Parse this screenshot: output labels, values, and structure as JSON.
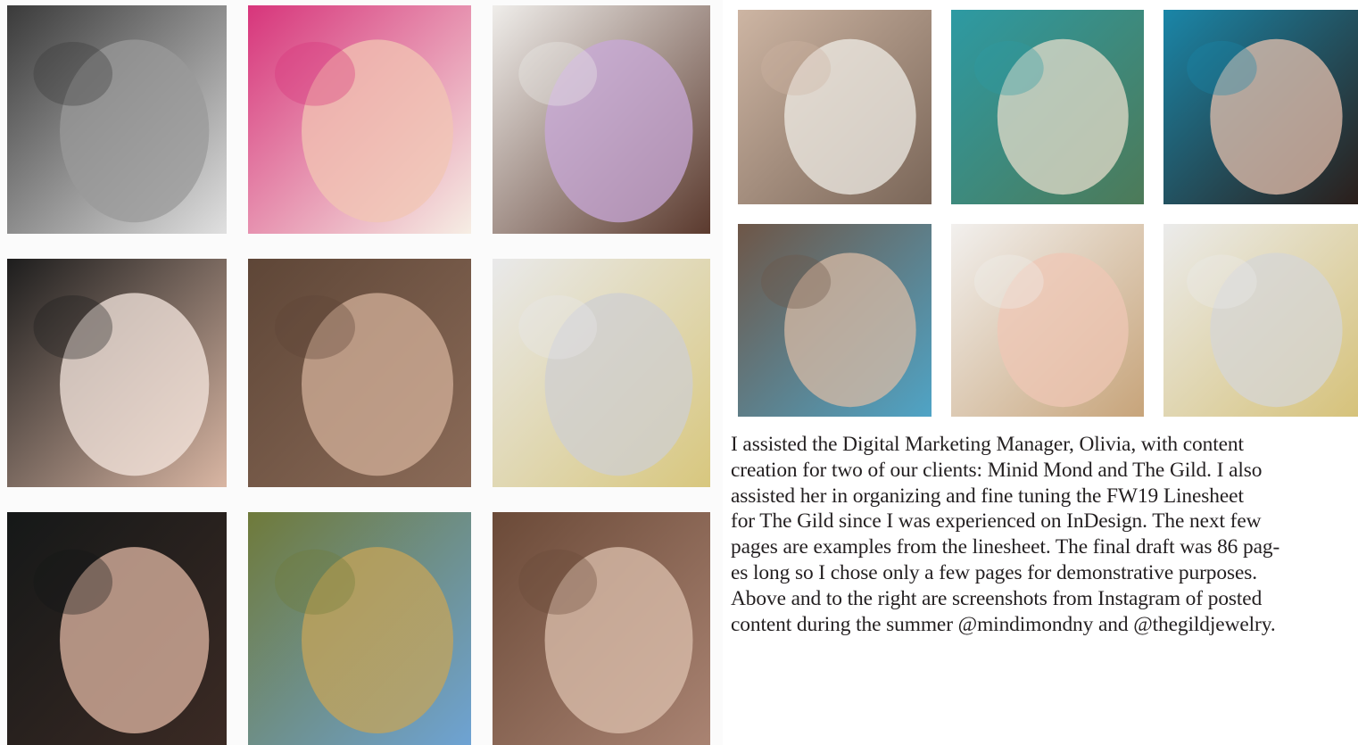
{
  "left_grid": {
    "tiles": [
      {
        "name": "vintage-bw-photo",
        "palette": [
          "#3a3a3a",
          "#9a9a9a",
          "#e0e0e0"
        ]
      },
      {
        "name": "hand-rings-pink-peony",
        "palette": [
          "#d7357b",
          "#f1c5b3",
          "#f6eee4"
        ]
      },
      {
        "name": "woman-lilac-dress",
        "palette": [
          "#efedea",
          "#c8a8d8",
          "#5b3a2e"
        ]
      },
      {
        "name": "hand-rings-lattice",
        "palette": [
          "#1d1d1d",
          "#f5e7df",
          "#d9b6a3"
        ]
      },
      {
        "name": "earring-brown-hair",
        "palette": [
          "#5e4637",
          "#d3b09a",
          "#8b6b58"
        ]
      },
      {
        "name": "bangles-marble",
        "palette": [
          "#e9e9ea",
          "#cfcfd1",
          "#d8c77e"
        ]
      },
      {
        "name": "woman-black-gown",
        "palette": [
          "#151818",
          "#e2b8a4",
          "#3b2a24"
        ]
      },
      {
        "name": "wizard-of-oz-still",
        "palette": [
          "#6f7a3a",
          "#c6a45a",
          "#6ea3d4"
        ]
      },
      {
        "name": "earring-side-profile",
        "palette": [
          "#6b4a38",
          "#dcc0ae",
          "#a98372"
        ]
      }
    ]
  },
  "right_grid": {
    "tiles": [
      {
        "name": "hand-wide-rings",
        "palette": [
          "#cdb5a3",
          "#efece6",
          "#7a6658"
        ]
      },
      {
        "name": "hotel-postcard-collage",
        "palette": [
          "#2d9aa3",
          "#e4dccb",
          "#4d7a58"
        ]
      },
      {
        "name": "woman-blue-background",
        "palette": [
          "#1a86a8",
          "#e6c0ad",
          "#2b1e1a"
        ]
      },
      {
        "name": "earring-blue-drop",
        "palette": [
          "#6e5647",
          "#d8bba6",
          "#4fa4c6"
        ]
      },
      {
        "name": "hand-rings-white",
        "palette": [
          "#f2f0ee",
          "#efc7b6",
          "#c7a47a"
        ]
      },
      {
        "name": "open-ring-marble",
        "palette": [
          "#ebebeb",
          "#d5d5d6",
          "#d6c27a"
        ]
      }
    ]
  },
  "caption": {
    "lines": [
      "I assisted the Digital Marketing Manager, Olivia, with content",
      "creation for two of our clients: Minid Mond and The Gild. I also",
      "assisted her in organizing and fine tuning the FW19 Linesheet",
      "for The Gild since I was experienced on InDesign. The next few",
      "pages are examples from the linesheet. The final draft was 86 pag-",
      "es long so I chose only a few pages for demonstrative purposes.",
      "Above and to the right are screenshots from Instagram of posted",
      "content during the summer @mindimondny and @thegildjewelry."
    ]
  }
}
